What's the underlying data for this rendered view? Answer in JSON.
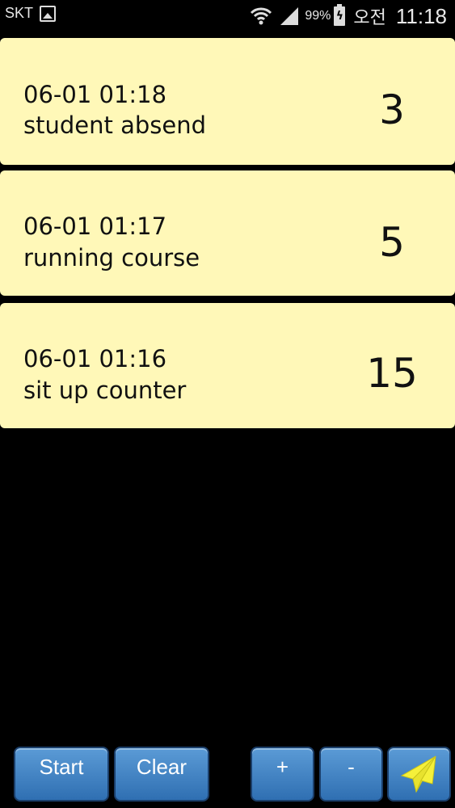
{
  "status_bar": {
    "carrier": "SKT",
    "battery_percent": "99%",
    "ampm": "오전",
    "time": "11:18"
  },
  "records": [
    {
      "time": "06-01 01:18",
      "label": "student absend",
      "count": "3"
    },
    {
      "time": "06-01 01:17",
      "label": "running course",
      "count": "5"
    },
    {
      "time": "06-01 01:16",
      "label": "sit up counter",
      "count": "15"
    }
  ],
  "toolbar": {
    "start_label": "Start",
    "clear_label": "Clear",
    "plus_label": "+",
    "minus_label": "-",
    "send_icon": "paper-plane-icon"
  },
  "colors": {
    "card_background": "#fff8b8",
    "button_blue": "#3d83c6",
    "send_icon": "#f5f03a"
  }
}
